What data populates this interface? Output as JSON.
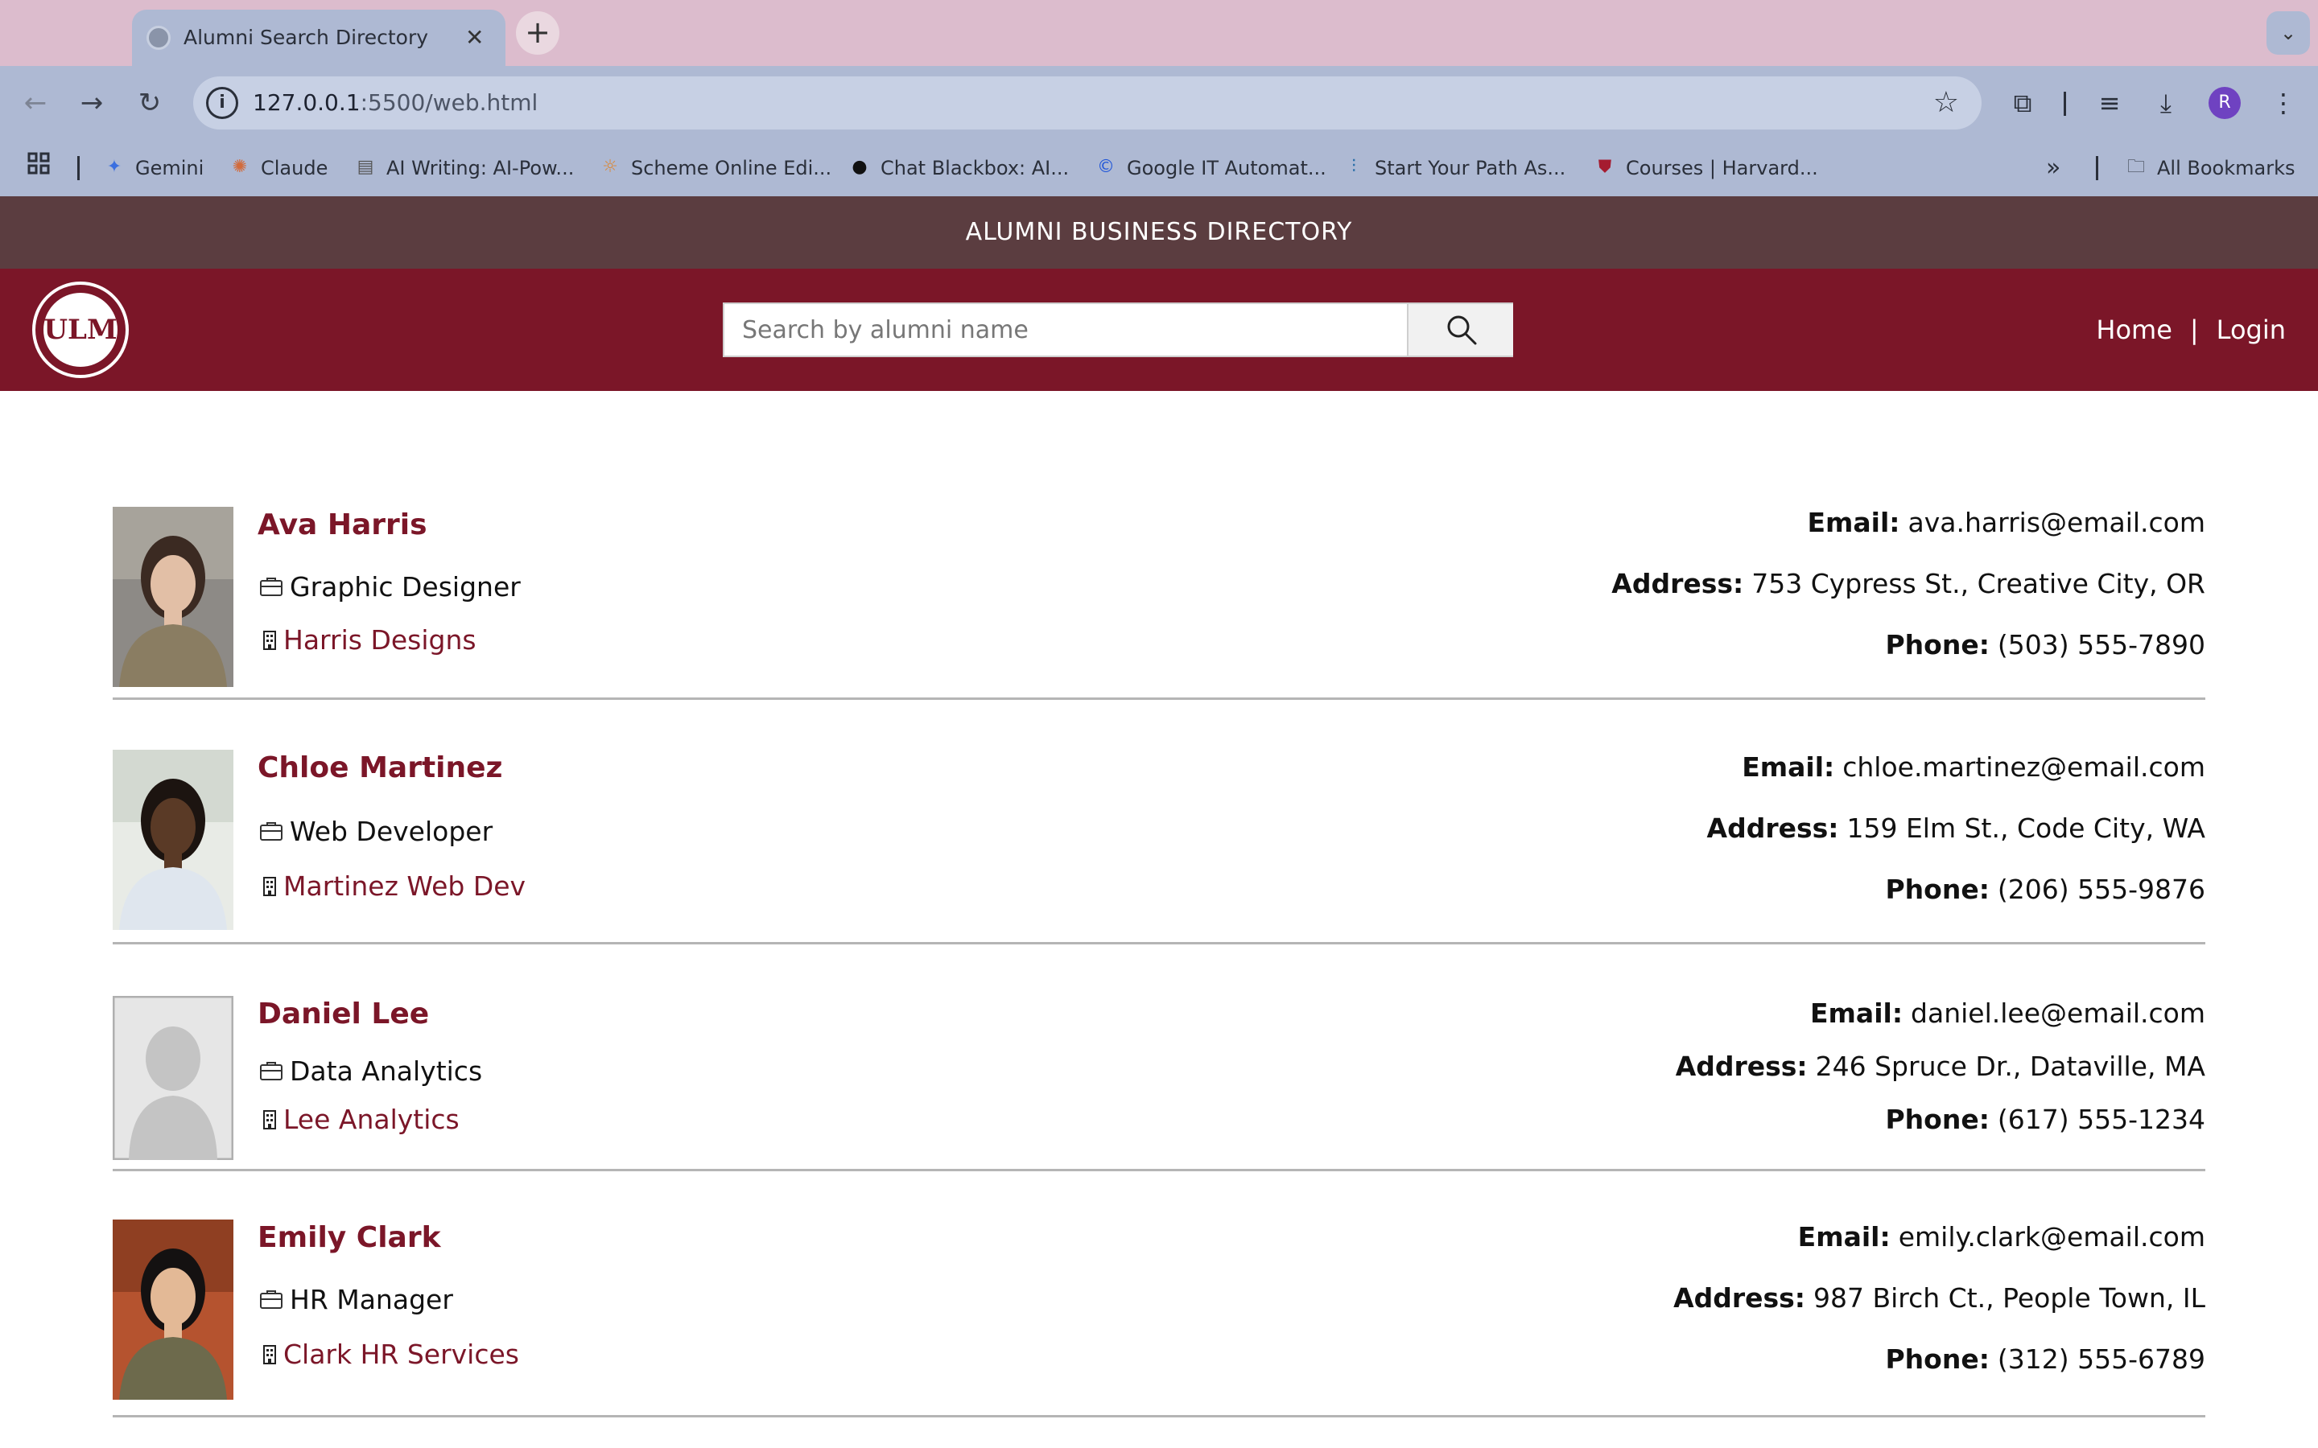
{
  "browser": {
    "tab_title": "Alumni Search Directory",
    "tab_close": "✕",
    "new_tab": "+",
    "url_host": "127.0.0.1",
    "url_path": ":5500/web.html",
    "bookmarks": [
      {
        "label": "Gemini",
        "icon": "gemini-icon"
      },
      {
        "label": "Claude",
        "icon": "claude-icon"
      },
      {
        "label": "AI Writing: AI-Pow...",
        "icon": "page-icon"
      },
      {
        "label": "Scheme Online Edi...",
        "icon": "sun-icon"
      },
      {
        "label": "Chat Blackbox: AI...",
        "icon": "blackbox-icon"
      },
      {
        "label": "Google IT Automat...",
        "icon": "coursera-icon"
      },
      {
        "label": "Start Your Path As...",
        "icon": "cisco-icon"
      },
      {
        "label": "Courses | Harvard...",
        "icon": "harvard-shield-icon"
      }
    ],
    "all_bookmarks": "All Bookmarks",
    "profile_initial": "R"
  },
  "site": {
    "banner": "ALUMNI BUSINESS DIRECTORY",
    "logo_text": "ULM",
    "search_placeholder": "Search by alumni name",
    "nav_home": "Home",
    "nav_sep": "|",
    "nav_login": "Login",
    "accent_color": "#7b1628",
    "banner_color": "#5b3d40"
  },
  "labels": {
    "email": "Email:",
    "address": "Address:",
    "phone": "Phone:"
  },
  "alumni": [
    {
      "name": "Ava Harris",
      "title": "Graphic Designer",
      "company": "Harris Designs",
      "email": "ava.harris@email.com",
      "address": "753 Cypress St., Creative City, OR",
      "phone": "(503) 555-7890"
    },
    {
      "name": "Chloe Martinez",
      "title": "Web Developer",
      "company": "Martinez Web Dev",
      "email": "chloe.martinez@email.com",
      "address": "159 Elm St., Code City, WA",
      "phone": "(206) 555-9876"
    },
    {
      "name": "Daniel Lee",
      "title": "Data Analytics",
      "company": "Lee Analytics",
      "email": "daniel.lee@email.com",
      "address": "246 Spruce Dr., Dataville, MA",
      "phone": "(617) 555-1234"
    },
    {
      "name": "Emily Clark",
      "title": "HR Manager",
      "company": "Clark HR Services",
      "email": "emily.clark@email.com",
      "address": "987 Birch Ct., People Town, IL",
      "phone": "(312) 555-6789"
    }
  ]
}
